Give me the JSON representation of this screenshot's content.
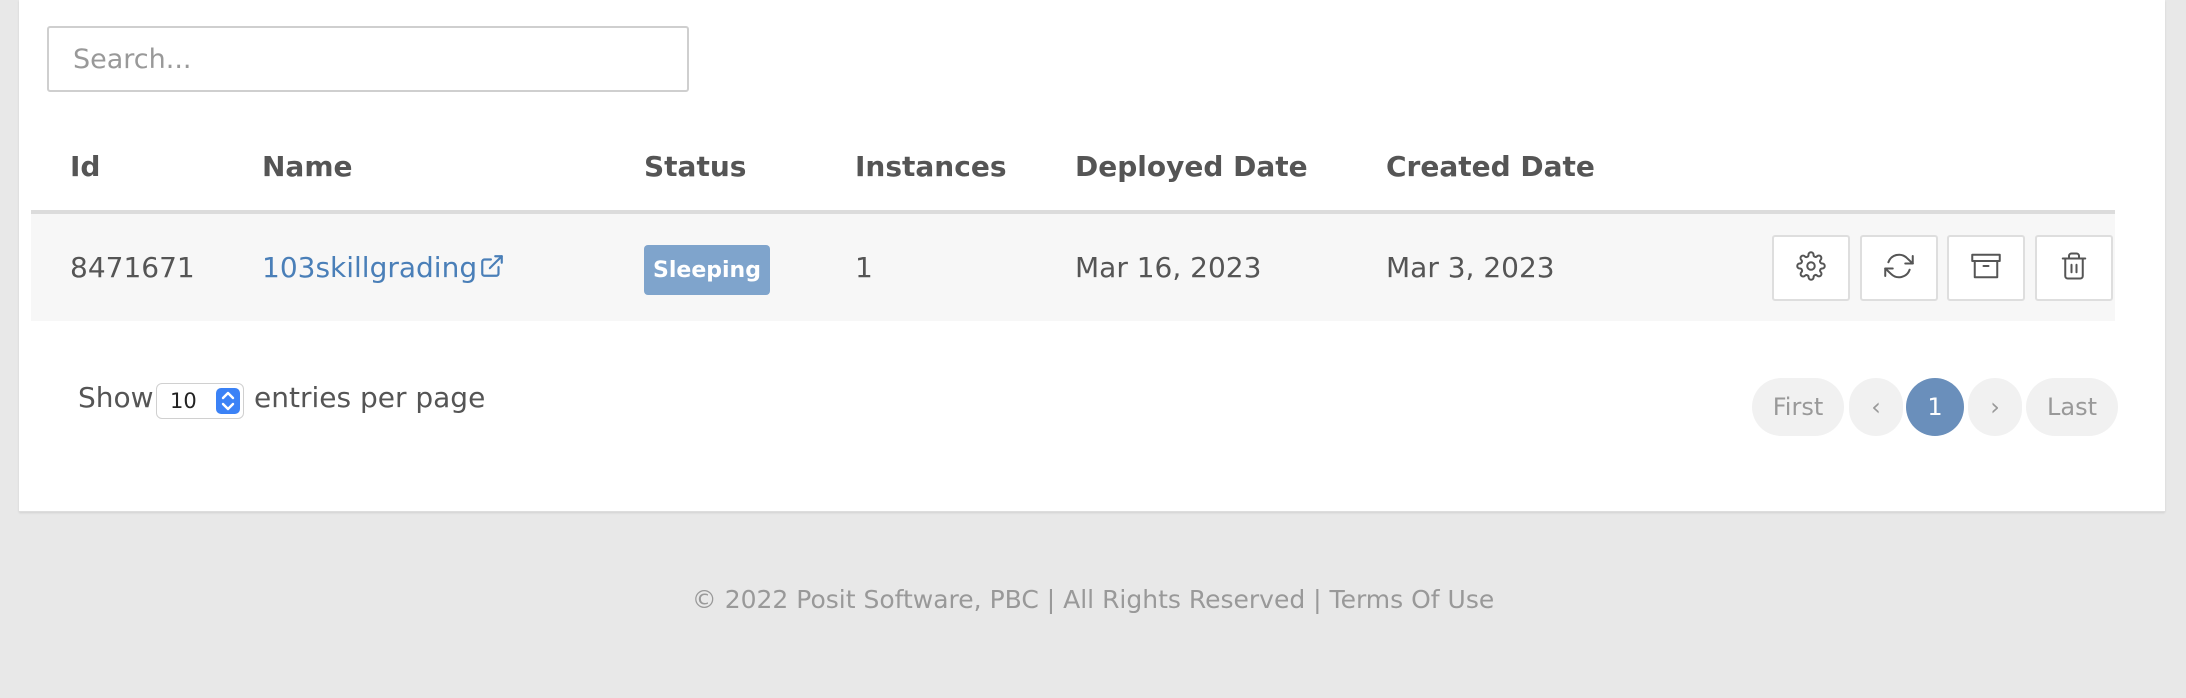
{
  "search": {
    "placeholder": "Search..."
  },
  "table": {
    "columns": {
      "id": "Id",
      "name": "Name",
      "status": "Status",
      "instances": "Instances",
      "deployed": "Deployed Date",
      "created": "Created Date"
    },
    "rows": [
      {
        "id": "8471671",
        "name": "103skillgrading",
        "status": "Sleeping",
        "instances": "1",
        "deployed": "Mar 16, 2023",
        "created": "Mar 3, 2023",
        "actions": [
          "gear-icon",
          "refresh-icon",
          "archive-icon",
          "trash-icon"
        ]
      }
    ]
  },
  "entries": {
    "prefix": "Show",
    "value": "10",
    "suffix": "entries per page"
  },
  "pagination": {
    "first": "First",
    "prev": "‹",
    "current": "1",
    "next": "›",
    "last": "Last"
  },
  "footer": {
    "text": "© 2022 Posit Software, PBC | All Rights Reserved | Terms Of Use"
  },
  "colors": {
    "link": "#4a7fb8",
    "badge": "#7fa4cc",
    "active_page": "#6a8fbb",
    "select_accent": "#3b82f6"
  }
}
